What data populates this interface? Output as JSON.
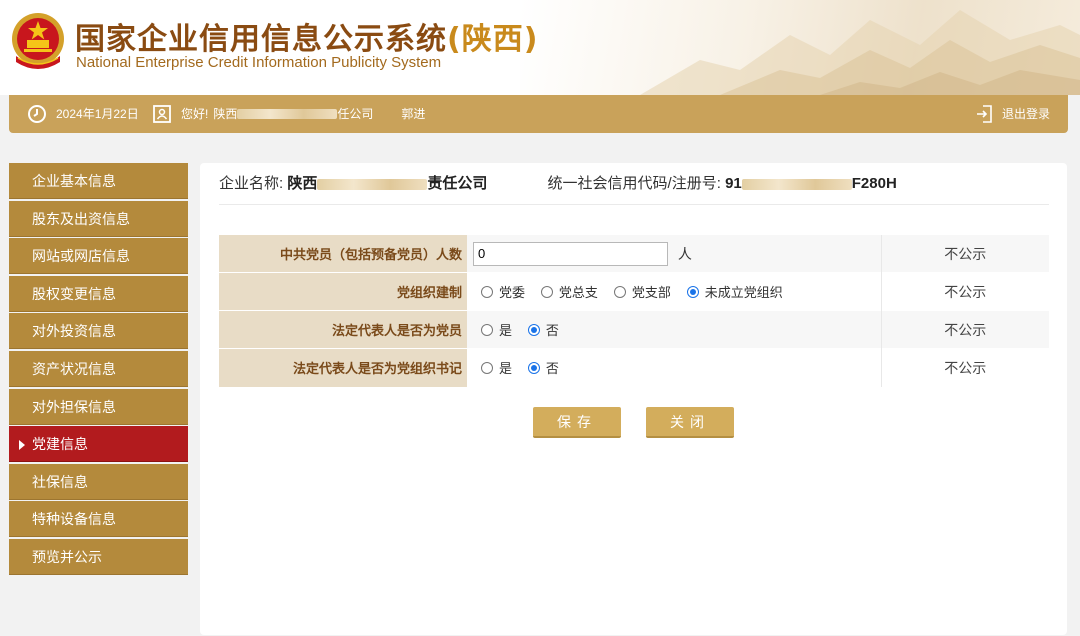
{
  "header": {
    "title_main": "国家企业信用信息公示系统",
    "title_province": "(陕西)",
    "title_en": "National Enterprise Credit Information Publicity System"
  },
  "topbar": {
    "date": "2024年1月22日",
    "greeting": "您好!",
    "company_prefix": "陕西",
    "company_suffix": "任公司",
    "user": "郭进",
    "logout": "退出登录"
  },
  "sidebar": {
    "items": [
      {
        "label": "企业基本信息"
      },
      {
        "label": "股东及出资信息"
      },
      {
        "label": "网站或网店信息"
      },
      {
        "label": "股权变更信息"
      },
      {
        "label": "对外投资信息"
      },
      {
        "label": "资产状况信息"
      },
      {
        "label": "对外担保信息"
      },
      {
        "label": "党建信息",
        "active": true
      },
      {
        "label": "社保信息"
      },
      {
        "label": "特种设备信息"
      },
      {
        "label": "预览并公示"
      }
    ]
  },
  "company": {
    "name_label": "企业名称:",
    "name_prefix": "陕西",
    "name_suffix": "责任公司",
    "code_label": "统一社会信用代码/注册号:",
    "code_prefix": "91",
    "code_suffix": "F280H"
  },
  "form": {
    "rows": [
      {
        "label": "中共党员（包括预备党员）人数",
        "value": "0",
        "unit": "人",
        "publicity": "不公示"
      },
      {
        "label": "党组织建制",
        "options": [
          "党委",
          "党总支",
          "党支部",
          "未成立党组织"
        ],
        "selected": "未成立党组织",
        "publicity": "不公示"
      },
      {
        "label": "法定代表人是否为党员",
        "options": [
          "是",
          "否"
        ],
        "selected": "否",
        "publicity": "不公示"
      },
      {
        "label": "法定代表人是否为党组织书记",
        "options": [
          "是",
          "否"
        ],
        "selected": "否",
        "publicity": "不公示"
      }
    ]
  },
  "buttons": {
    "save": "保存",
    "close": "关闭"
  }
}
